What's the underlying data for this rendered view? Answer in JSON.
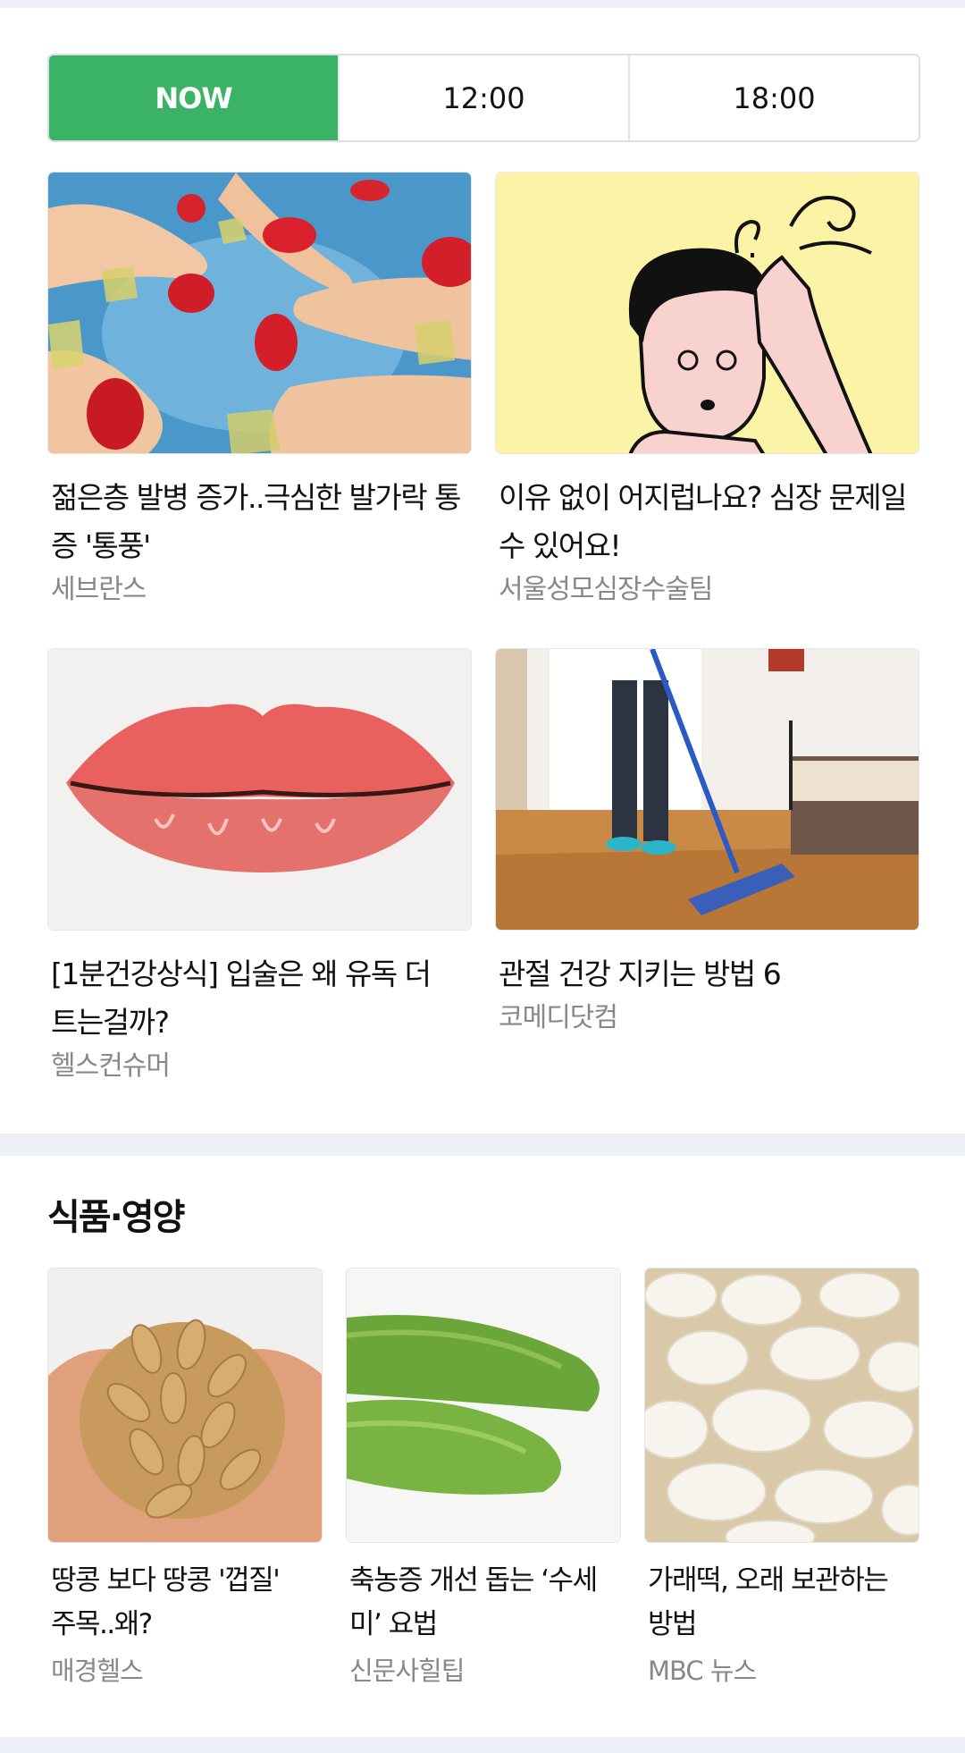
{
  "tabs": [
    {
      "label": "NOW",
      "active": true
    },
    {
      "label": "12:00",
      "active": false
    },
    {
      "label": "18:00",
      "active": false
    }
  ],
  "news": [
    {
      "title": "젊은층 발병 증가..극심한 발가락 통증 '통풍'",
      "source": "세브란스",
      "image": "gout-feet-illustration"
    },
    {
      "title": "이유 없이 어지럽나요? 심장 문제일 수 있어요!",
      "source": "서울성모심장수술팀",
      "image": "dizzy-person-illustration"
    },
    {
      "title": "[1분건강상식] 입술은 왜 유독 더 트는걸까?",
      "source": "헬스컨슈머",
      "image": "chapped-lips-illustration"
    },
    {
      "title": "관절 건강 지키는 방법 6",
      "source": "코메디닷컴",
      "image": "person-mopping-floor-photo"
    }
  ],
  "food_section": {
    "title": "식품·영양",
    "items": [
      {
        "title": "땅콩 보다 땅콩 '껍질' 주목..왜?",
        "source": "매경헬스",
        "image": "peanuts-in-hands-photo"
      },
      {
        "title": "축농증 개선 돕는 ‘수세미’ 요법",
        "source": "신문사힐팁",
        "image": "loofah-gourd-photo"
      },
      {
        "title": "가래떡, 오래 보관하는 방법",
        "source": "MBC 뉴스",
        "image": "sliced-rice-cake-photo"
      }
    ]
  },
  "colors": {
    "accent": "#3bb366",
    "source_text": "#888888",
    "background_band": "#edf0f6"
  }
}
